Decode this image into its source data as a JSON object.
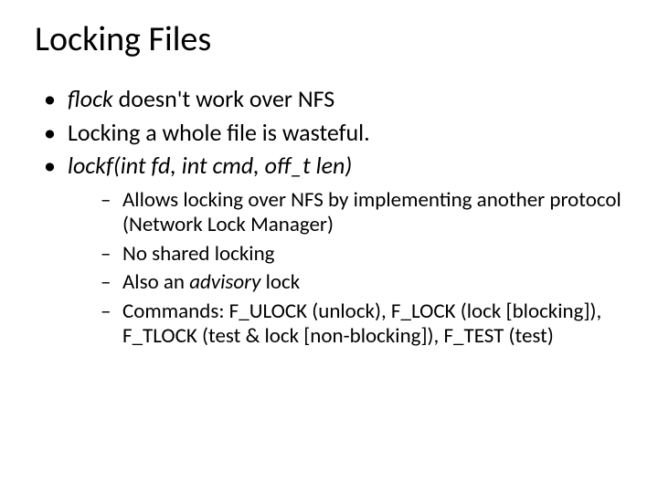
{
  "title": "Locking Files",
  "bullets": {
    "b1": {
      "flock": "flock",
      "rest": " doesn't work over NFS"
    },
    "b2": "Locking a whole file is wasteful.",
    "b3": "lockf(int fd, int cmd, off_t len)"
  },
  "sub": {
    "s1": {
      "pre": " Allows locking over NFS by implementing another protocol (",
      "nlm": "Network Lock Manager",
      "post": ")"
    },
    "s2": "No shared locking",
    "s3": {
      "pre": "Also an ",
      "adv": "advisory",
      "post": " lock"
    },
    "s4": {
      "pre": "Commands: F_ULOCK ",
      "unlock": "(unlock)",
      "mid1": ", F_LOCK ",
      "lockblocking": "(lock [blocking])",
      "mid2": ", F_TLOCK ",
      "testlock": "(test & lock [non-blocking])",
      "mid3": ", F_TEST ",
      "test": "(test)"
    }
  }
}
